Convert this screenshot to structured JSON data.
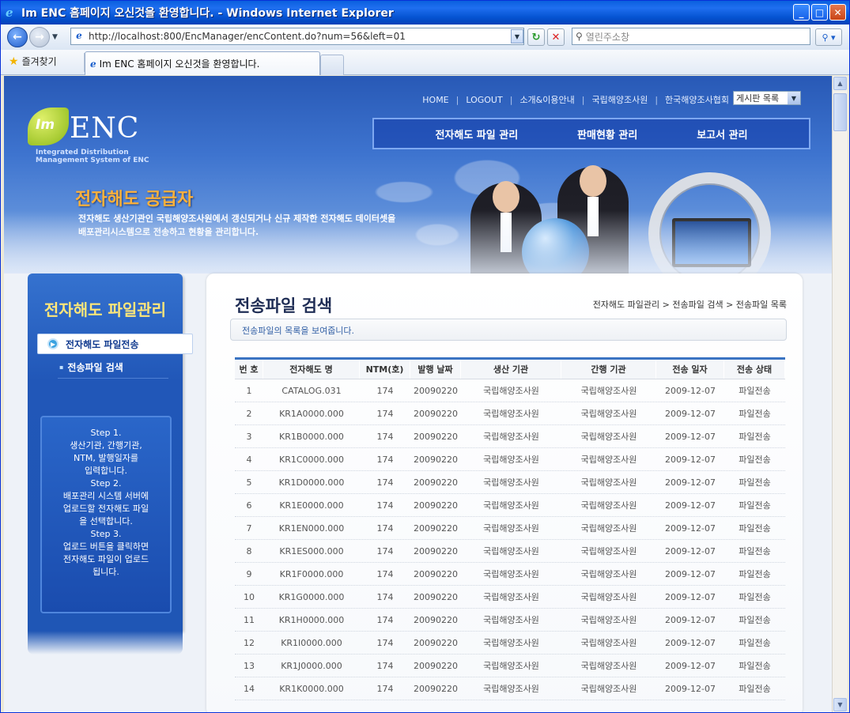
{
  "window": {
    "title": "Im ENC 홈페이지 오신것을 환영합니다. - Windows Internet Explorer"
  },
  "address": {
    "url": "http://localhost:800/EncManager/encContent.do?num=56&left=01",
    "search_placeholder": "열린주소창"
  },
  "favorites": {
    "label": "즐겨찾기",
    "tab_title": "Im ENC 홈페이지 오신것을 환영합니다."
  },
  "topnav": {
    "items": [
      "HOME",
      "LOGOUT",
      "소개&이용안내",
      "국립해양조사원",
      "한국해양조사협회"
    ],
    "select": "게시판 목록"
  },
  "mainmenu": [
    "전자해도 파일 관리",
    "판매현황 관리",
    "보고서 관리"
  ],
  "logo": {
    "lm": "Im",
    "enc": "ENC",
    "sub1": "Integrated Distribution",
    "sub2": "Management System of ENC"
  },
  "hero": {
    "title": "전자해도 공급자",
    "desc1": "전자해도 생산기관인 국립해양조사원에서 갱신되거나 신규 제작한 전자해도 데이터셋을",
    "desc2": "배포관리시스템으로 전송하고 현황을 관리합니다."
  },
  "sidebar": {
    "title": "전자해도 파일관리",
    "active": "전자해도 파일전송",
    "sub": "전송파일 검색",
    "steps": [
      "Step 1.",
      "생산기관, 간행기관,",
      "NTM, 발행일자를",
      "입력합니다.",
      "Step 2.",
      "배포관리 시스템 서버에",
      "업로드할 전자해도 파일",
      "을 선택합니다.",
      "Step 3.",
      "업로드 버튼을 클릭하면",
      "전자해도 파일이 업로드",
      "됩니다."
    ]
  },
  "content": {
    "title": "전송파일 검색",
    "breadcrumb": "전자해도 파일관리 > 전송파일 검색 > 전송파일 목록",
    "info": "전송파일의 목록을 보여줍니다."
  },
  "table": {
    "headers": [
      "번 호",
      "전자해도 명",
      "NTM(호)",
      "발행 날짜",
      "생산 기관",
      "간행 기관",
      "전송 일자",
      "전송 상태"
    ],
    "rows": [
      [
        "1",
        "CATALOG.031",
        "174",
        "20090220",
        "국립해양조사원",
        "국립해양조사원",
        "2009-12-07",
        "파일전송"
      ],
      [
        "2",
        "KR1A0000.000",
        "174",
        "20090220",
        "국립해양조사원",
        "국립해양조사원",
        "2009-12-07",
        "파일전송"
      ],
      [
        "3",
        "KR1B0000.000",
        "174",
        "20090220",
        "국립해양조사원",
        "국립해양조사원",
        "2009-12-07",
        "파일전송"
      ],
      [
        "4",
        "KR1C0000.000",
        "174",
        "20090220",
        "국립해양조사원",
        "국립해양조사원",
        "2009-12-07",
        "파일전송"
      ],
      [
        "5",
        "KR1D0000.000",
        "174",
        "20090220",
        "국립해양조사원",
        "국립해양조사원",
        "2009-12-07",
        "파일전송"
      ],
      [
        "6",
        "KR1E0000.000",
        "174",
        "20090220",
        "국립해양조사원",
        "국립해양조사원",
        "2009-12-07",
        "파일전송"
      ],
      [
        "7",
        "KR1EN000.000",
        "174",
        "20090220",
        "국립해양조사원",
        "국립해양조사원",
        "2009-12-07",
        "파일전송"
      ],
      [
        "8",
        "KR1ES000.000",
        "174",
        "20090220",
        "국립해양조사원",
        "국립해양조사원",
        "2009-12-07",
        "파일전송"
      ],
      [
        "9",
        "KR1F0000.000",
        "174",
        "20090220",
        "국립해양조사원",
        "국립해양조사원",
        "2009-12-07",
        "파일전송"
      ],
      [
        "10",
        "KR1G0000.000",
        "174",
        "20090220",
        "국립해양조사원",
        "국립해양조사원",
        "2009-12-07",
        "파일전송"
      ],
      [
        "11",
        "KR1H0000.000",
        "174",
        "20090220",
        "국립해양조사원",
        "국립해양조사원",
        "2009-12-07",
        "파일전송"
      ],
      [
        "12",
        "KR1I0000.000",
        "174",
        "20090220",
        "국립해양조사원",
        "국립해양조사원",
        "2009-12-07",
        "파일전송"
      ],
      [
        "13",
        "KR1J0000.000",
        "174",
        "20090220",
        "국립해양조사원",
        "국립해양조사원",
        "2009-12-07",
        "파일전송"
      ],
      [
        "14",
        "KR1K0000.000",
        "174",
        "20090220",
        "국립해양조사원",
        "국립해양조사원",
        "2009-12-07",
        "파일전송"
      ]
    ]
  }
}
